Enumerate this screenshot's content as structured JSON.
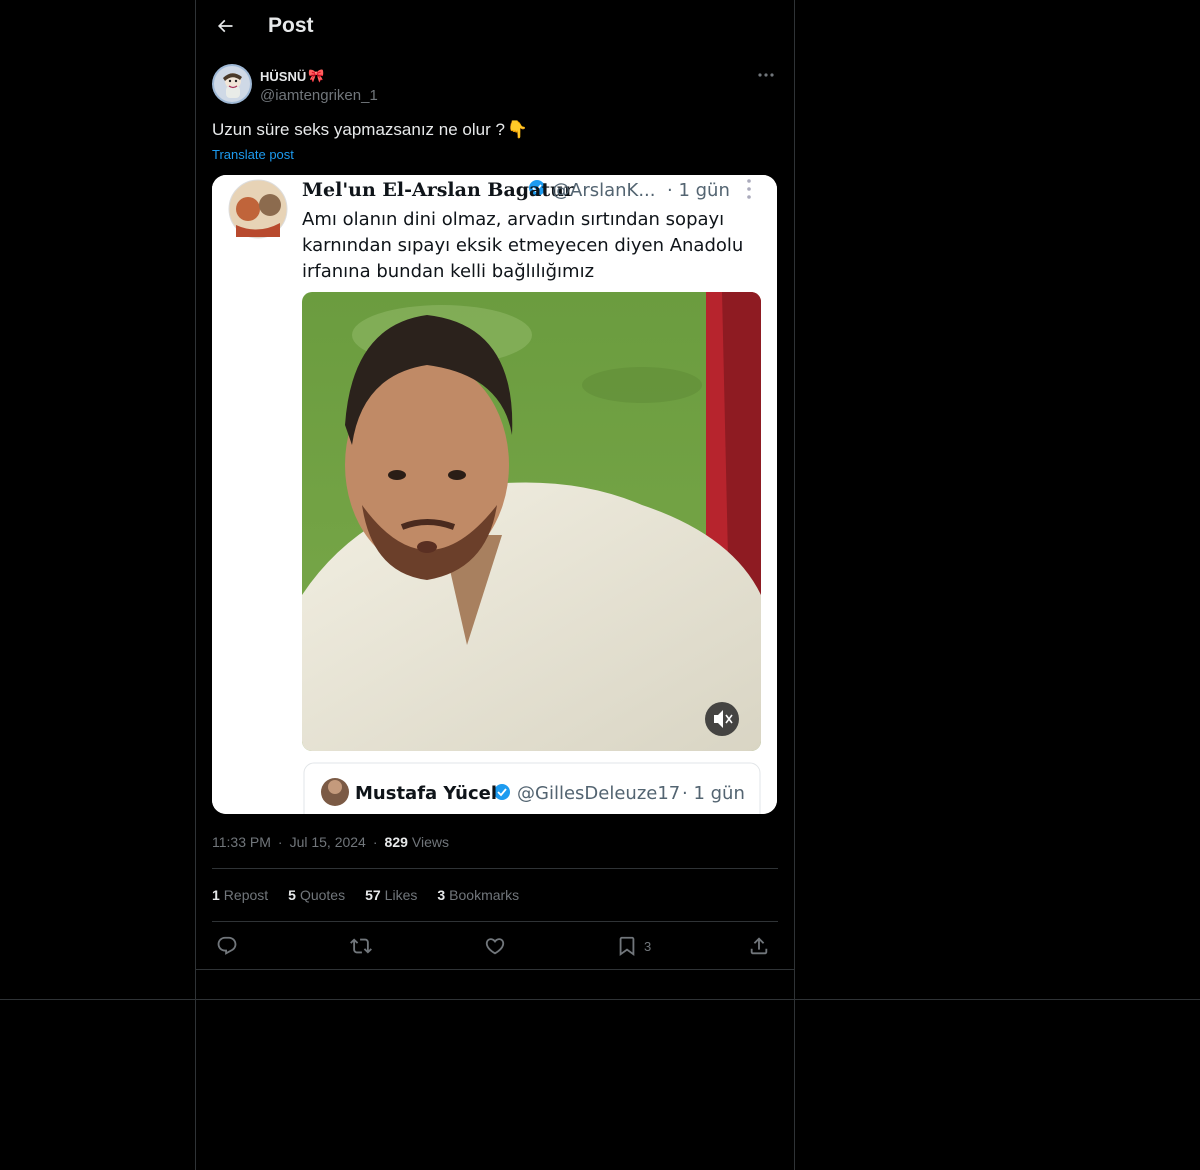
{
  "header": {
    "title": "Post"
  },
  "author": {
    "display_name": "HÜSNÜ",
    "emoji": "🎀",
    "handle": "@iamtengriken_1"
  },
  "post": {
    "text": "Uzun süre seks yapmazsanız ne olur ?",
    "text_emoji": "👇",
    "translate_label": "Translate post"
  },
  "embedded_screenshot": {
    "author_name": "Mel'un El-Arslan Bagatur",
    "author_handle": "@ArslanK...",
    "time": "· 1 gün",
    "text_line1": "Amı olanın dini olmaz, arvadın sırtından sopayı",
    "text_line2": "karnından sıpayı eksik etmeyecen diyen Anadolu",
    "text_line3": "irfanına bundan kelli bağlılığımız",
    "reply_name": "Mustafa Yücel",
    "reply_handle": "@GillesDeleuze17",
    "reply_time": "· 1 gün"
  },
  "meta": {
    "time": "11:33 PM",
    "date": "Jul 15, 2024",
    "views_count": "829",
    "views_label": "Views"
  },
  "stats": {
    "reposts_count": "1",
    "reposts_label": "Repost",
    "quotes_count": "5",
    "quotes_label": "Quotes",
    "likes_count": "57",
    "likes_label": "Likes",
    "bookmarks_count": "3",
    "bookmarks_label": "Bookmarks"
  },
  "actions": {
    "bookmark_count": "3"
  },
  "icons": {
    "back": "arrow-left-icon",
    "more": "more-dots-icon",
    "reply": "reply-icon",
    "repost": "repost-icon",
    "like": "heart-icon",
    "bookmark": "bookmark-icon",
    "share": "share-icon",
    "mute": "mute-icon",
    "verified": "verified-badge-icon"
  },
  "colors": {
    "background": "#000000",
    "border": "#2f3336",
    "text_primary": "#e7e9ea",
    "text_secondary": "#71767b",
    "link": "#1d9bf0"
  }
}
